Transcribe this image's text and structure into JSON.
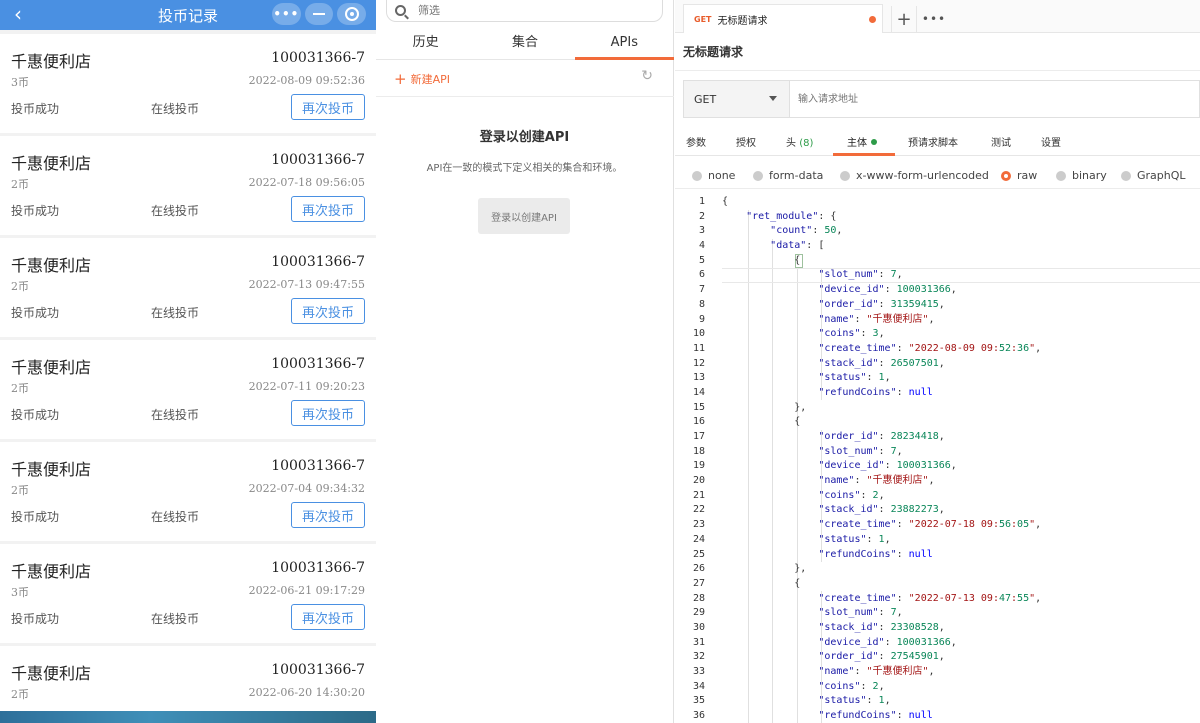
{
  "mobile": {
    "nav_title": "投币记录",
    "back_icon": "chevron-left-icon",
    "capsule_more": "•••",
    "records": [
      {
        "store": "千惠便利店",
        "device": "100031366-7",
        "coins": "3币",
        "time": "2022-08-09 09:52:36",
        "status": "投币成功",
        "method": "在线投币",
        "button": "再次投币"
      },
      {
        "store": "千惠便利店",
        "device": "100031366-7",
        "coins": "2币",
        "time": "2022-07-18 09:56:05",
        "status": "投币成功",
        "method": "在线投币",
        "button": "再次投币"
      },
      {
        "store": "千惠便利店",
        "device": "100031366-7",
        "coins": "2币",
        "time": "2022-07-13 09:47:55",
        "status": "投币成功",
        "method": "在线投币",
        "button": "再次投币"
      },
      {
        "store": "千惠便利店",
        "device": "100031366-7",
        "coins": "2币",
        "time": "2022-07-11 09:20:23",
        "status": "投币成功",
        "method": "在线投币",
        "button": "再次投币"
      },
      {
        "store": "千惠便利店",
        "device": "100031366-7",
        "coins": "2币",
        "time": "2022-07-04 09:34:32",
        "status": "投币成功",
        "method": "在线投币",
        "button": "再次投币"
      },
      {
        "store": "千惠便利店",
        "device": "100031366-7",
        "coins": "3币",
        "time": "2022-06-21 09:17:29",
        "status": "投币成功",
        "method": "在线投币",
        "button": "再次投币"
      },
      {
        "store": "千惠便利店",
        "device": "100031366-7",
        "coins": "2币",
        "time": "2022-06-20 14:30:20",
        "status": "",
        "method": "",
        "button": ""
      }
    ]
  },
  "sidebar": {
    "filter_placeholder": "筛选",
    "tabs": [
      "历史",
      "集合",
      "APIs"
    ],
    "new_api": "新建API",
    "login_title": "登录以创建API",
    "login_desc": "API在一致的模式下定义相关的集合和环境。",
    "login_button": "登录以创建API"
  },
  "request": {
    "tab_method": "GET",
    "tab_title": "无标题请求",
    "name": "无标题请求",
    "method": "GET",
    "url_placeholder": "输入请求地址",
    "subtabs": [
      {
        "label": "参数",
        "count": ""
      },
      {
        "label": "授权",
        "count": ""
      },
      {
        "label": "头",
        "count": "(8)"
      },
      {
        "label": "主体",
        "count": ""
      },
      {
        "label": "预请求脚本",
        "count": ""
      },
      {
        "label": "测试",
        "count": ""
      },
      {
        "label": "设置",
        "count": ""
      }
    ],
    "body_types": [
      "none",
      "form-data",
      "x-www-form-urlencoded",
      "raw",
      "binary",
      "GraphQL"
    ],
    "selected_body_type": "raw",
    "code_lines": [
      "{",
      "    \"ret_module\": {",
      "        \"count\": 50,",
      "        \"data\": [",
      "            {",
      "                \"slot_num\": 7,",
      "                \"device_id\": 100031366,",
      "                \"order_id\": 31359415,",
      "                \"name\": \"千惠便利店\",",
      "                \"coins\": 3,",
      "                \"create_time\": \"2022-08-09 09:52:36\",",
      "                \"stack_id\": 26507501,",
      "                \"status\": 1,",
      "                \"refundCoins\": null",
      "            },",
      "            {",
      "                \"order_id\": 28234418,",
      "                \"slot_num\": 7,",
      "                \"device_id\": 100031366,",
      "                \"name\": \"千惠便利店\",",
      "                \"coins\": 2,",
      "                \"stack_id\": 23882273,",
      "                \"create_time\": \"2022-07-18 09:56:05\",",
      "                \"status\": 1,",
      "                \"refundCoins\": null",
      "            },",
      "            {",
      "                \"create_time\": \"2022-07-13 09:47:55\",",
      "                \"slot_num\": 7,",
      "                \"stack_id\": 23308528,",
      "                \"device_id\": 100031366,",
      "                \"order_id\": 27545901,",
      "                \"name\": \"千惠便利店\",",
      "                \"coins\": 2,",
      "                \"status\": 1,",
      "                \"refundCoins\": null"
    ]
  }
}
